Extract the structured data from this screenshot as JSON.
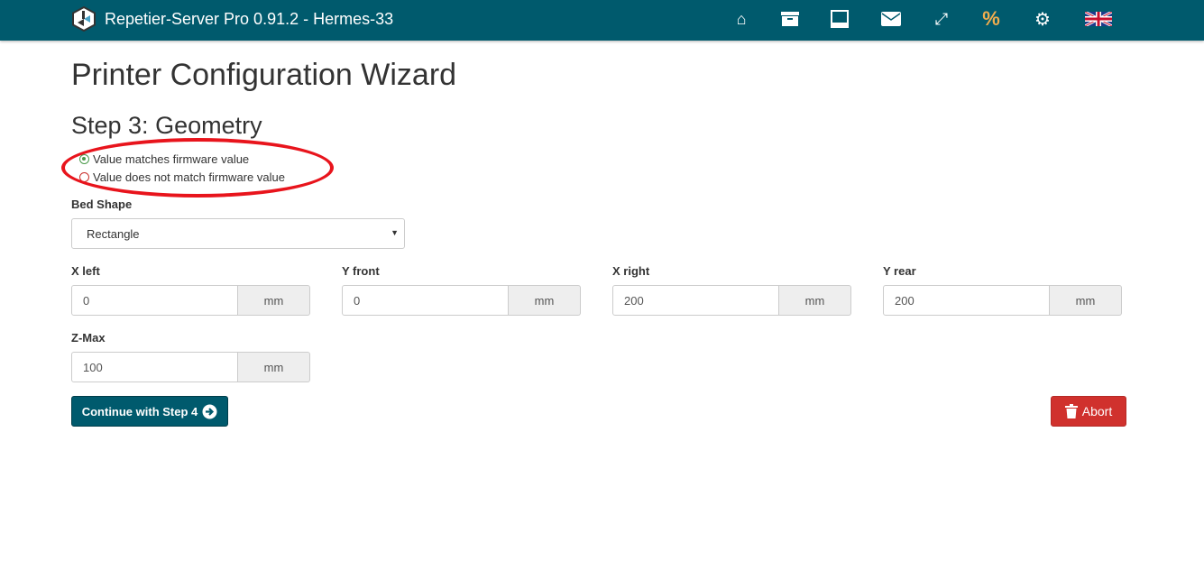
{
  "header": {
    "title": "Repetier-Server Pro 0.91.2 - Hermes-33",
    "icons": [
      "home-icon",
      "archive-icon",
      "printer-icon",
      "envelope-icon",
      "expand-icon",
      "percent-icon",
      "gear-icon",
      "uk-flag-icon"
    ]
  },
  "page": {
    "title": "Printer Configuration Wizard",
    "step": "Step 3: Geometry"
  },
  "legend": {
    "match": "Value matches firmware value",
    "nomatch": "Value does not match firmware value"
  },
  "bed": {
    "label": "Bed Shape",
    "value": "Rectangle"
  },
  "fields": [
    {
      "label": "X left",
      "value": "0",
      "unit": "mm"
    },
    {
      "label": "Y front",
      "value": "0",
      "unit": "mm"
    },
    {
      "label": "X right",
      "value": "200",
      "unit": "mm"
    },
    {
      "label": "Y rear",
      "value": "200",
      "unit": "mm"
    },
    {
      "label": "Z-Max",
      "value": "100",
      "unit": "mm"
    }
  ],
  "buttons": {
    "continue": "Continue with Step 4",
    "abort": "Abort"
  },
  "colors": {
    "header": "#005a6d",
    "match": "#4a9a4a",
    "nomatch": "#c9302c",
    "abort": "#d0312d",
    "annotation": "#e8141c"
  }
}
